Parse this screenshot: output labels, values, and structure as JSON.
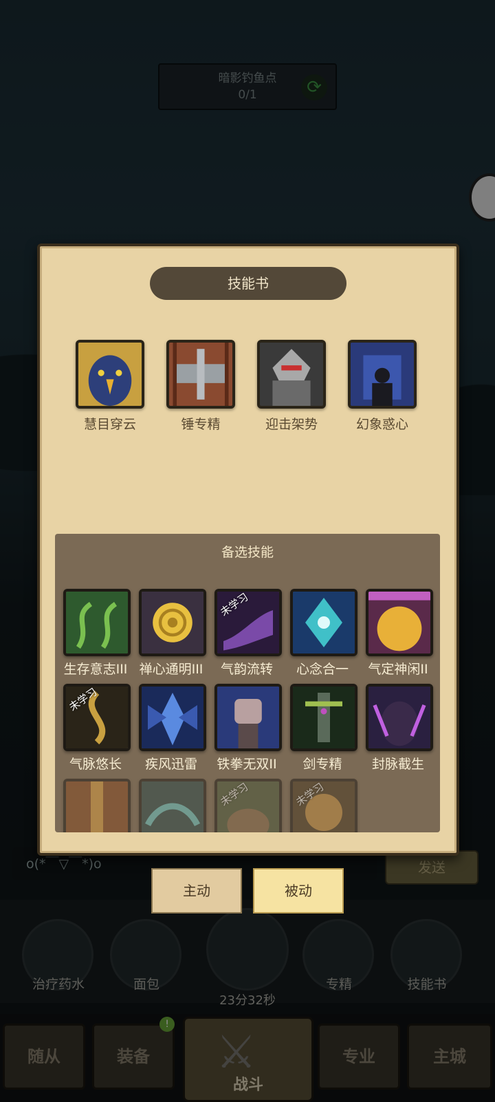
{
  "quest": {
    "title": "暗影钓鱼点",
    "progress": "0/1"
  },
  "panel": {
    "title": "技能书",
    "equipped": [
      {
        "label": "慧目穿云",
        "icon": "eagle-icon"
      },
      {
        "label": "锤专精",
        "icon": "hammer-icon"
      },
      {
        "label": "迎击架势",
        "icon": "knight-icon"
      },
      {
        "label": "幻象惑心",
        "icon": "phantom-icon"
      }
    ],
    "alternatives_title": "备选技能",
    "alternatives": [
      {
        "label": "生存意志III",
        "icon": "vines-icon"
      },
      {
        "label": "禅心通明III",
        "icon": "spiral-icon"
      },
      {
        "label": "气韵流转",
        "icon": "flow-icon",
        "badge": "未学习"
      },
      {
        "label": "心念合一",
        "icon": "crystal-icon"
      },
      {
        "label": "气定神闲II",
        "icon": "torso-icon"
      },
      {
        "label": "气脉悠长",
        "icon": "tree-icon",
        "badge": "未学习"
      },
      {
        "label": "疾风迅雷",
        "icon": "blade-icon"
      },
      {
        "label": "铁拳无双II",
        "icon": "fist-icon"
      },
      {
        "label": "剑专精",
        "icon": "sword-icon"
      },
      {
        "label": "封脉截生",
        "icon": "chain-icon"
      },
      {
        "label": "",
        "icon": "gate-icon"
      },
      {
        "label": "",
        "icon": "wave-icon"
      },
      {
        "label": "",
        "icon": "bear-icon",
        "badge": "未学习"
      },
      {
        "label": "",
        "icon": "sun-icon",
        "badge": "未学习"
      }
    ]
  },
  "tabs": {
    "active": "主动",
    "passive": "被动"
  },
  "chat": {
    "text": "o(*￣▽￣*)o",
    "send": "发送"
  },
  "items": [
    "治疗药水",
    "面包",
    "专精",
    "技能书"
  ],
  "timer": "23分32秒",
  "nav": {
    "left1": "随从",
    "left2": "装备",
    "center": "战斗",
    "right1": "专业",
    "right2": "主城"
  }
}
